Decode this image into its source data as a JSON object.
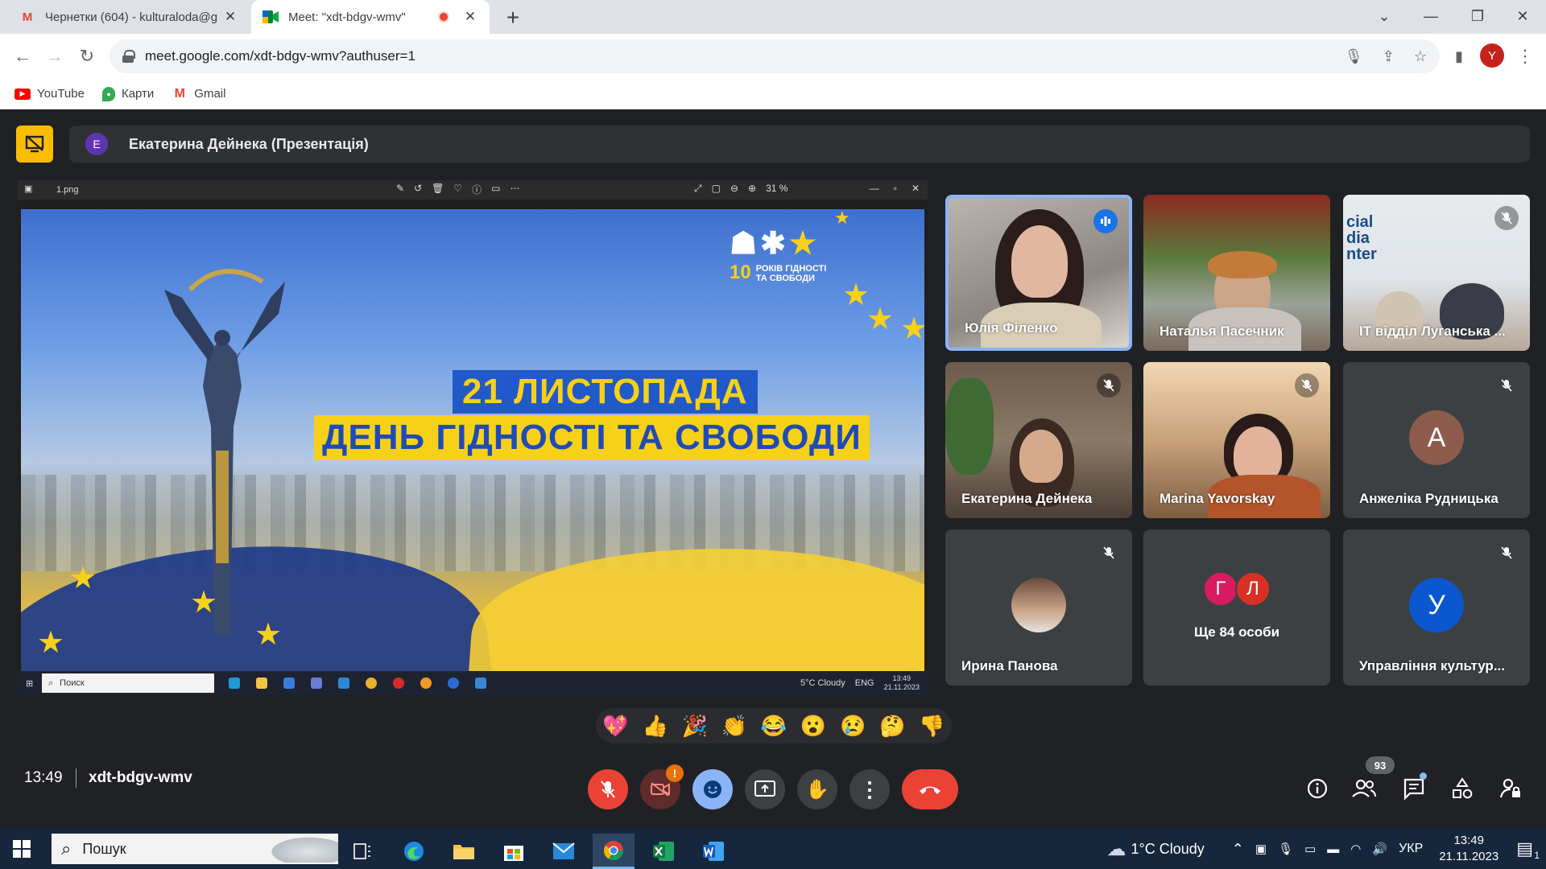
{
  "browser": {
    "tabs": [
      {
        "title": "Чернетки (604) - kulturaloda@g",
        "active": false,
        "favicon": "gmail-icon"
      },
      {
        "title": "Meet: \"xdt-bdgv-wmv\"",
        "active": true,
        "favicon": "meet-icon"
      }
    ],
    "url": "meet.google.com/xdt-bdgv-wmv?authuser=1",
    "profile_initial": "Y",
    "bookmarks": [
      {
        "label": "YouTube",
        "icon": "youtube-icon"
      },
      {
        "label": "Карти",
        "icon": "maps-icon"
      },
      {
        "label": "Gmail",
        "icon": "gmail-icon"
      }
    ]
  },
  "meet": {
    "presenter_initial": "E",
    "presenter_label": "Екатерина Дейнека (Презентація)",
    "presentation": {
      "file_name": "1.png",
      "zoom": "31 %",
      "slide_date": "21 ЛИСТОПАДА",
      "slide_title": "ДЕНЬ ГІДНОСТІ ТА СВОБОДИ",
      "slide_logo_number": "10",
      "slide_logo_text_1": "РОКІВ ГІДНОСТІ",
      "slide_logo_text_2": "ТА СВОБОДИ",
      "inner_taskbar": {
        "search": "Поиск",
        "weather": "5°C Cloudy",
        "lang": "ENG",
        "time": "13:49",
        "date": "21.11.2023"
      }
    },
    "participants": [
      {
        "name": "Юлія Філенко",
        "state": "speaking"
      },
      {
        "name": "Наталья Пасечник",
        "state": "video"
      },
      {
        "name": "IT відділ Луганська ...",
        "state": "muted"
      },
      {
        "name": "Екатерина Дейнека",
        "state": "muted"
      },
      {
        "name": "Marina Yavorskay",
        "state": "muted"
      },
      {
        "name": "Анжеліка Рудницька",
        "state": "muted",
        "initial": "А",
        "color": "#8d5b4c"
      },
      {
        "name": "Ирина Панова",
        "state": "muted"
      },
      {
        "name": "Ще 84 особи",
        "initials": [
          "Г",
          "Л"
        ],
        "colors": [
          "#d81b60",
          "#d93025"
        ]
      },
      {
        "name": "Управління культур...",
        "state": "muted",
        "initial": "У",
        "color": "#0b57d0"
      }
    ],
    "reactions": [
      "💖",
      "👍",
      "🎉",
      "👏",
      "😂",
      "😮",
      "😢",
      "🤔",
      "👎"
    ],
    "time": "13:49",
    "meeting_code": "xdt-bdgv-wmv",
    "people_count": "93",
    "camera_alert": "!"
  },
  "taskbar": {
    "search_placeholder": "Пошук",
    "weather": "1°C  Cloudy",
    "lang": "УКР",
    "time": "13:49",
    "date": "21.11.2023",
    "notifications": "1"
  },
  "colors": {
    "meet_bg": "#202124",
    "accent_blue": "#8ab4f8",
    "danger_red": "#ea4335",
    "present_yellow": "#fbbc04"
  }
}
